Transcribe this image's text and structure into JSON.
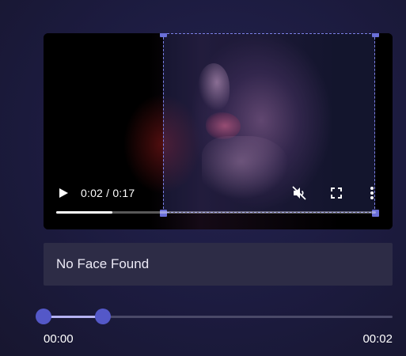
{
  "video": {
    "time_display": "0:02 / 0:17",
    "progress": 0.176,
    "play_icon": "play-icon",
    "mute_icon": "volume-muted-icon",
    "fullscreen_icon": "fullscreen-icon",
    "more_icon": "more-vertical-icon"
  },
  "status": {
    "message": "No Face Found"
  },
  "range": {
    "start_label": "00:00",
    "end_label": "00:02",
    "start_fraction": 0.0,
    "end_fraction": 0.169
  },
  "colors": {
    "background": "#1c1b3f",
    "accent": "#5458c8",
    "crop_border": "#7b80e6",
    "status_box": "#2d2c46",
    "range_fill": "#b5b2f2"
  }
}
